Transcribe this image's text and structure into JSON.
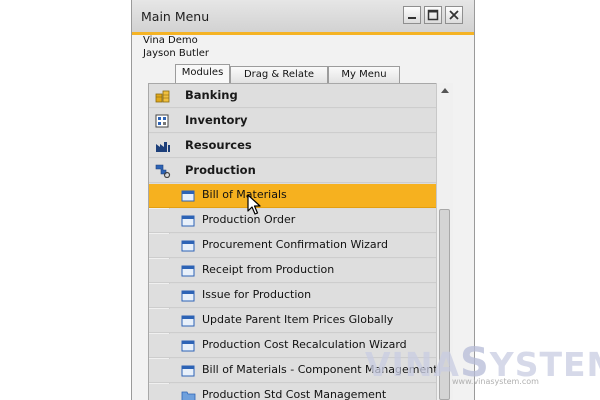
{
  "window": {
    "title": "Main Menu",
    "company": "Vina Demo",
    "user": "Jayson Butler",
    "accent_color": "#f5b324"
  },
  "tabs": [
    {
      "label": "Modules",
      "active": true
    },
    {
      "label": "Drag & Relate",
      "active": false
    },
    {
      "label": "My Menu",
      "active": false
    }
  ],
  "modules": [
    {
      "label": "Banking",
      "icon": "banking-icon"
    },
    {
      "label": "Inventory",
      "icon": "inventory-icon"
    },
    {
      "label": "Resources",
      "icon": "resources-icon"
    },
    {
      "label": "Production",
      "icon": "production-icon"
    }
  ],
  "production_items": [
    {
      "label": "Bill of Materials",
      "icon": "form-icon",
      "selected": true
    },
    {
      "label": "Production Order",
      "icon": "form-icon"
    },
    {
      "label": "Procurement Confirmation Wizard",
      "icon": "form-icon"
    },
    {
      "label": "Receipt from Production",
      "icon": "form-icon"
    },
    {
      "label": "Issue for Production",
      "icon": "form-icon"
    },
    {
      "label": "Update Parent Item Prices Globally",
      "icon": "form-icon"
    },
    {
      "label": "Production Cost Recalculation Wizard",
      "icon": "form-icon"
    },
    {
      "label": "Bill of Materials - Component Management",
      "icon": "form-icon"
    },
    {
      "label": "Production Std Cost Management",
      "icon": "folder-icon"
    }
  ],
  "watermark": {
    "text_a": "VINA",
    "text_s": "S",
    "text_b": "YSTEM",
    "url": "www.vinasystem.com"
  }
}
